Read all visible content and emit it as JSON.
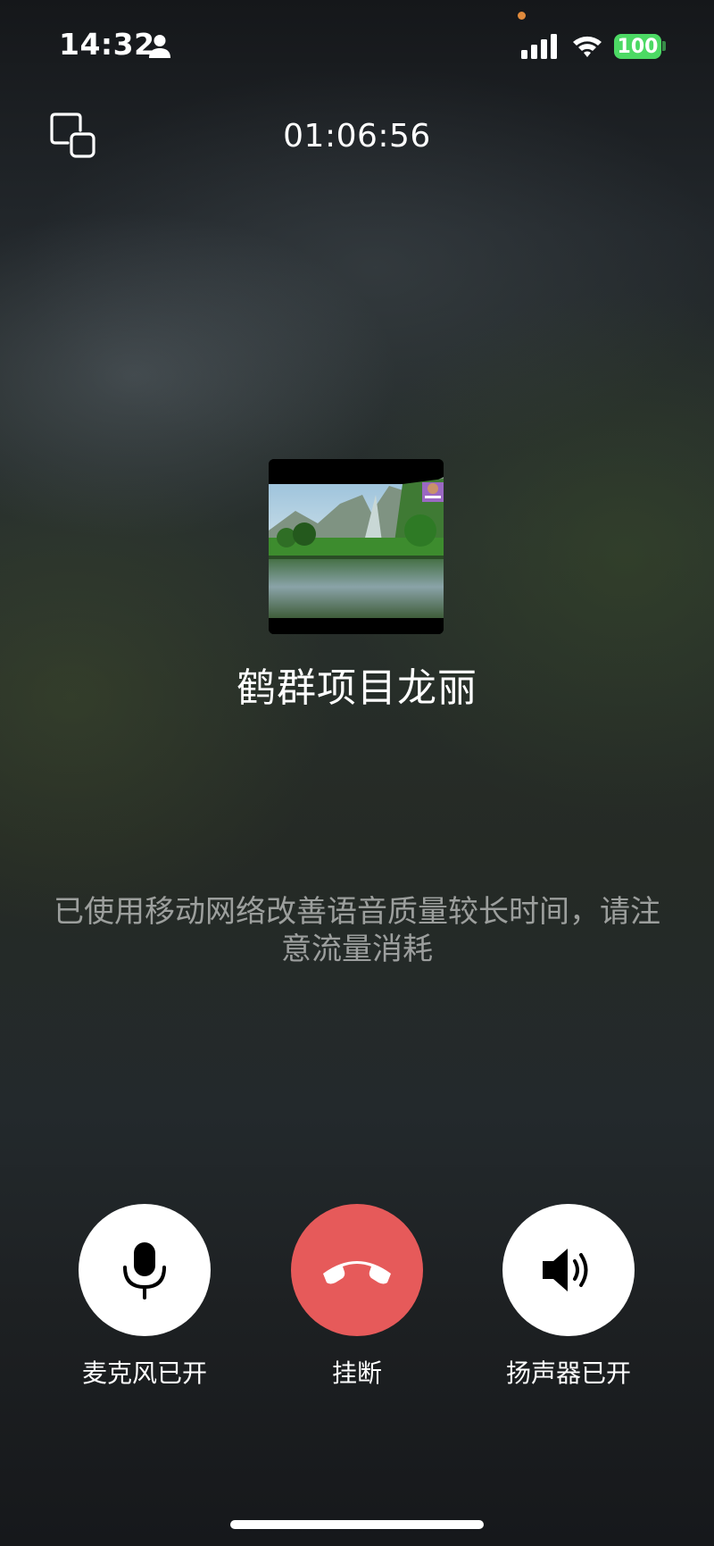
{
  "status_bar": {
    "time": "14:32",
    "battery": "100",
    "battery_color": "#4cd964"
  },
  "call": {
    "timer": "01:06:56",
    "caller_name": "鹤群项目龙丽",
    "notice": "已使用移动网络改善语音质量较长时间，请注意流量消耗"
  },
  "controls": {
    "mic_label": "麦克风已开",
    "hangup_label": "挂断",
    "speaker_label": "扬声器已开",
    "hangup_color": "#e65a5a"
  },
  "icons": {
    "minimize": "minimize-window-icon",
    "mic": "microphone-icon",
    "hangup": "phone-hangup-icon",
    "speaker": "speaker-icon",
    "signal": "cellular-signal-icon",
    "wifi": "wifi-icon",
    "person": "person-icon"
  }
}
